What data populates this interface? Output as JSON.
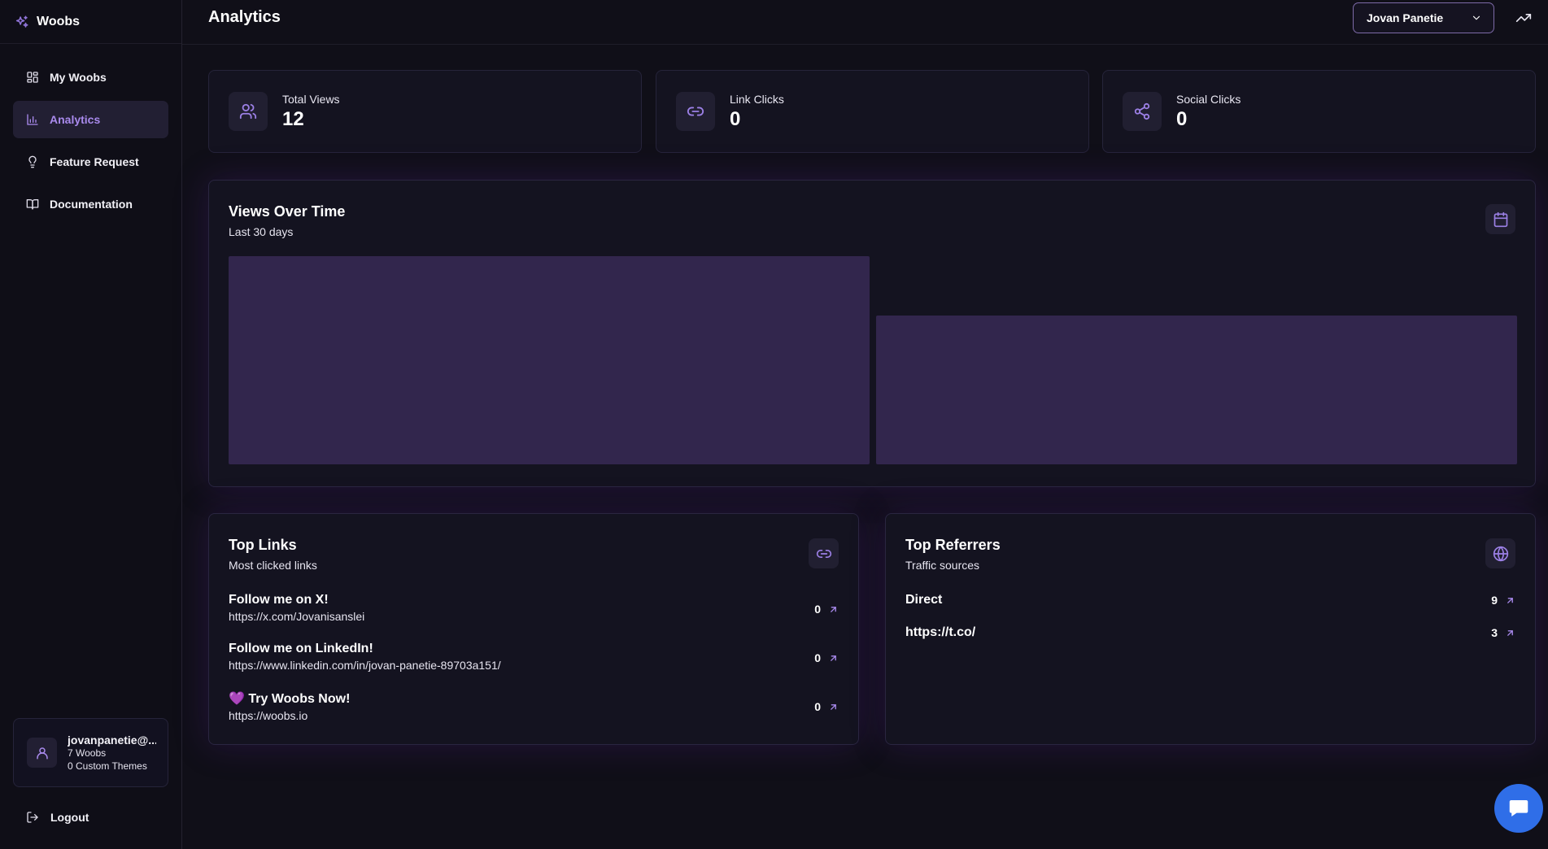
{
  "app": {
    "name": "Woobs"
  },
  "sidebar": {
    "items": [
      {
        "label": "My Woobs",
        "icon": "grid-icon",
        "active": false
      },
      {
        "label": "Analytics",
        "icon": "bar-chart-icon",
        "active": true
      },
      {
        "label": "Feature Request",
        "icon": "lightbulb-icon",
        "active": false
      },
      {
        "label": "Documentation",
        "icon": "book-icon",
        "active": false
      }
    ],
    "user": {
      "email": "jovanpanetie@...",
      "woobs": "7 Woobs",
      "themes": "0 Custom Themes"
    },
    "logout_label": "Logout"
  },
  "header": {
    "title": "Analytics",
    "account": "Jovan Panetie"
  },
  "stats": [
    {
      "label": "Total Views",
      "value": "12",
      "icon": "users-icon"
    },
    {
      "label": "Link Clicks",
      "value": "0",
      "icon": "link-icon"
    },
    {
      "label": "Social Clicks",
      "value": "0",
      "icon": "share-icon"
    }
  ],
  "views_chart": {
    "title": "Views Over Time",
    "subtitle": "Last 30 days",
    "chart_data": {
      "type": "bar",
      "values": [
        7,
        5
      ]
    }
  },
  "top_links": {
    "title": "Top Links",
    "subtitle": "Most clicked links",
    "rows": [
      {
        "title": "Follow me on X!",
        "url": "https://x.com/Jovanisanslei",
        "count": "0"
      },
      {
        "title": "Follow me on LinkedIn!",
        "url": "https://www.linkedin.com/in/jovan-panetie-89703a151/",
        "count": "0"
      },
      {
        "title": "💜 Try Woobs Now!",
        "url": "https://woobs.io",
        "count": "0"
      }
    ]
  },
  "top_referrers": {
    "title": "Top Referrers",
    "subtitle": "Traffic sources",
    "rows": [
      {
        "title": "Direct",
        "count": "9"
      },
      {
        "title": "https://t.co/",
        "count": "3"
      }
    ]
  },
  "colors": {
    "accent": "#a98aed",
    "background": "#100f18",
    "bar": "#32264d",
    "chat": "#2f6ee8"
  }
}
